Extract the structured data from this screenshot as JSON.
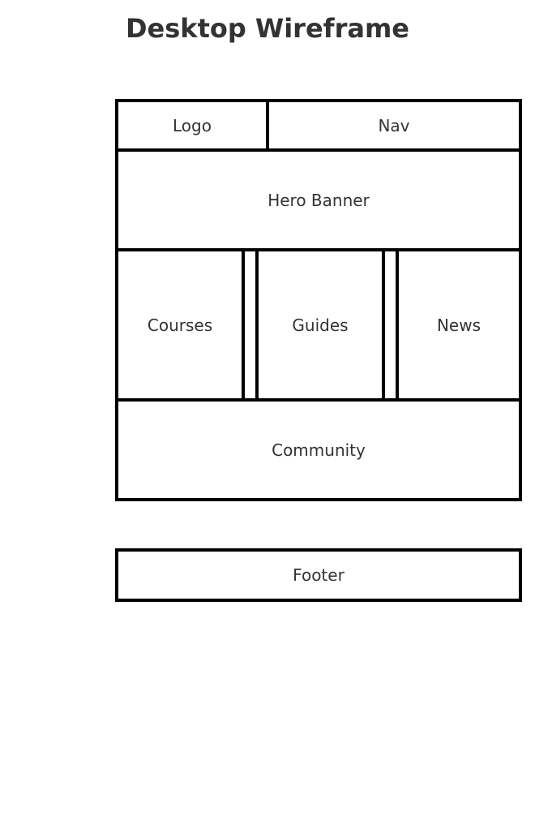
{
  "title": "Desktop Wireframe",
  "regions": {
    "logo": "Logo",
    "nav": "Nav",
    "hero": "Hero Banner",
    "courses": "Courses",
    "guides": "Guides",
    "news": "News",
    "community": "Community",
    "footer": "Footer"
  },
  "colors": {
    "text": "#333333",
    "border": "#000000",
    "background": "#ffffff"
  }
}
